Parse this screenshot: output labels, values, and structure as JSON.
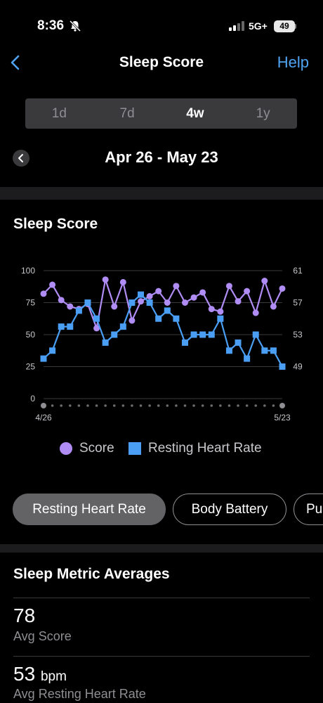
{
  "status": {
    "time": "8:36",
    "network": "5G+",
    "battery": "49"
  },
  "nav": {
    "title": "Sleep Score",
    "help": "Help"
  },
  "periods": [
    "1d",
    "7d",
    "4w",
    "1y"
  ],
  "active_period": "4w",
  "date_range": "Apr 26 - May 23",
  "section_title": "Sleep Score",
  "chart_data": {
    "type": "line",
    "x": [
      "4/26",
      "4/27",
      "4/28",
      "4/29",
      "4/30",
      "5/1",
      "5/2",
      "5/3",
      "5/4",
      "5/5",
      "5/6",
      "5/7",
      "5/8",
      "5/9",
      "5/10",
      "5/11",
      "5/12",
      "5/13",
      "5/14",
      "5/15",
      "5/16",
      "5/17",
      "5/18",
      "5/19",
      "5/20",
      "5/21",
      "5/22",
      "5/23"
    ],
    "x_tick_labels": [
      "4/26",
      "5/23"
    ],
    "y_left": {
      "ticks": [
        0,
        25,
        50,
        75,
        100
      ],
      "ylim": [
        0,
        100
      ]
    },
    "y_right": {
      "ticks": [
        49,
        53,
        57,
        61
      ],
      "ylim": [
        45,
        61
      ]
    },
    "series": [
      {
        "name": "Score",
        "axis": "left",
        "color": "#b08cf5",
        "marker": "circle",
        "values": [
          82,
          89,
          77,
          72,
          70,
          74,
          55,
          93,
          72,
          91,
          61,
          76,
          80,
          84,
          75,
          88,
          75,
          79,
          83,
          70,
          68,
          88,
          76,
          84,
          67,
          92,
          72,
          86
        ]
      },
      {
        "name": "Resting Heart Rate",
        "axis": "right",
        "color": "#4a9ff5",
        "marker": "square",
        "values": [
          50,
          51,
          54,
          54,
          56,
          57,
          55,
          52,
          53,
          54,
          57,
          58,
          57,
          55,
          56,
          55,
          52,
          53,
          53,
          53,
          55,
          51,
          52,
          50,
          53,
          51,
          51,
          49
        ]
      }
    ],
    "grid": true,
    "legend": "bottom"
  },
  "pills": [
    "Resting Heart Rate",
    "Body Battery",
    "Pu"
  ],
  "active_pill": "Resting Heart Rate",
  "averages": {
    "title": "Sleep Metric Averages",
    "items": [
      {
        "value": "78",
        "unit": "",
        "label": "Avg Score"
      },
      {
        "value": "53",
        "unit": "bpm",
        "label": "Avg Resting Heart Rate"
      }
    ]
  },
  "colors": {
    "accent": "#4fa3f0",
    "score": "#b08cf5",
    "heart_rate": "#4a9ff5"
  }
}
